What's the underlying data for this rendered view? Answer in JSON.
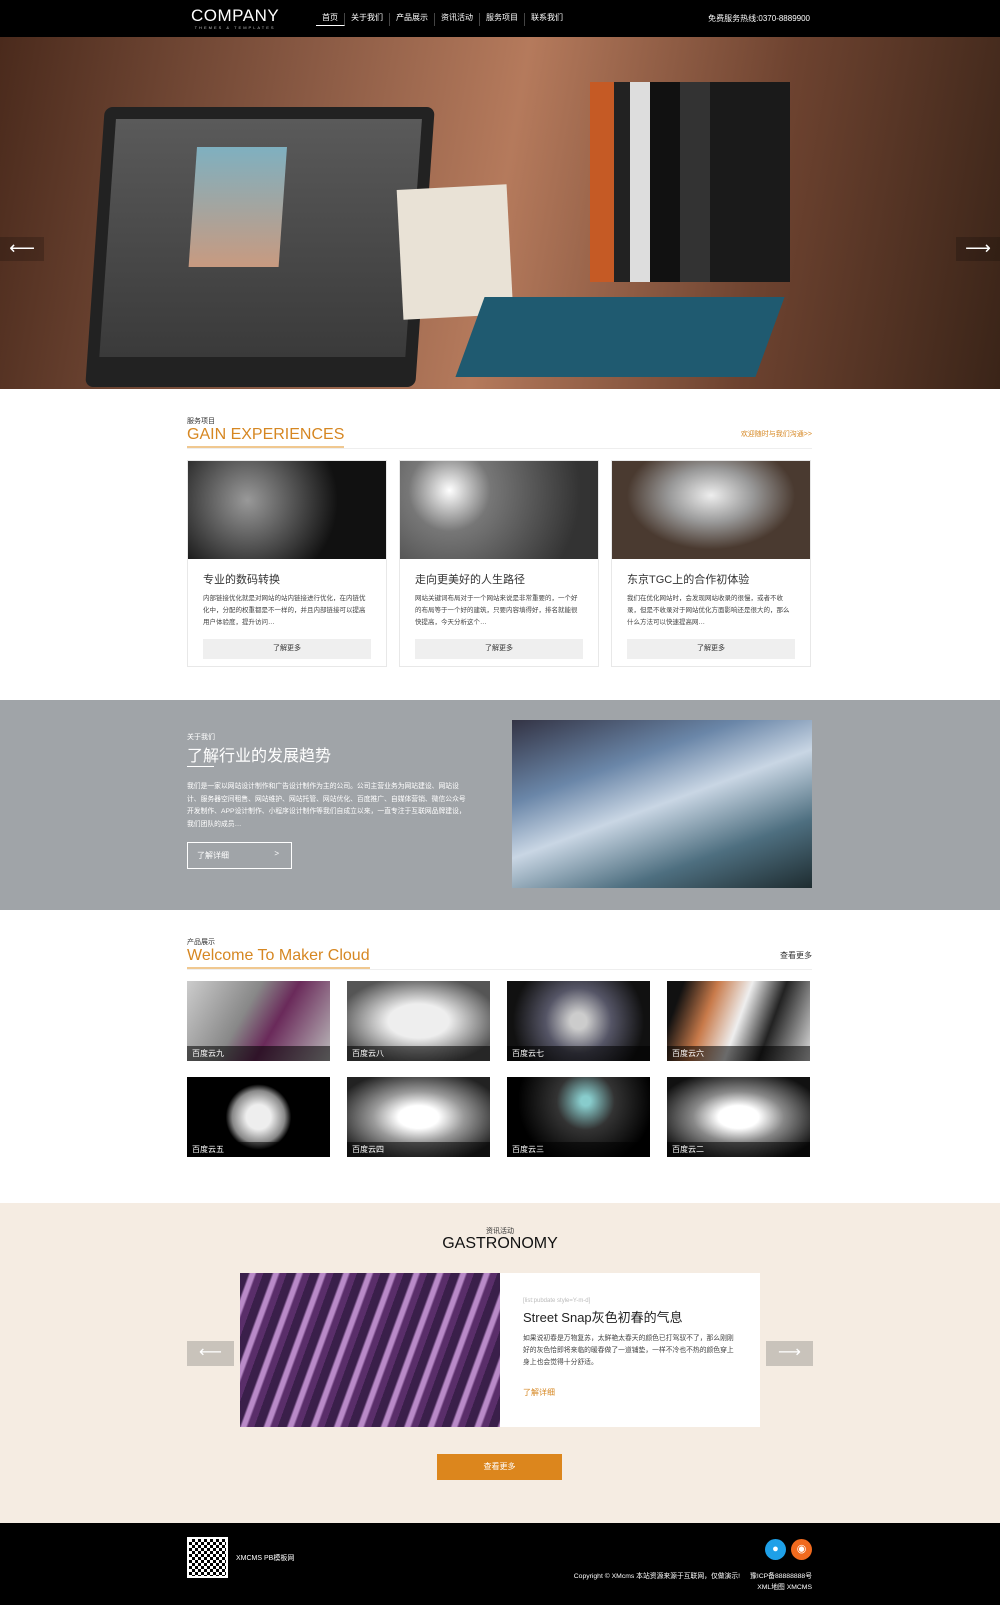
{
  "header": {
    "logo": "COMPANY",
    "logo_tagline": "THEMES & TEMPLATES",
    "nav": [
      "首页",
      "关于我们",
      "产品展示",
      "资讯活动",
      "服务项目",
      "联系我们"
    ],
    "hotline": "免费服务热线:0370-8889900"
  },
  "hero": {
    "prev_icon": "arrow-left-icon",
    "next_icon": "arrow-right-icon"
  },
  "services": {
    "subtitle": "服务项目",
    "title": "GAIN EXPERIENCES",
    "more": "欢迎随时与我们沟通>>",
    "cards": [
      {
        "title": "专业的数码转换",
        "text": "内部链接优化就是对网站的站内链接进行优化，在内链优化中，分配的权重都是不一样的，并且内部链接可以提高用户体验度，提升访问…",
        "button": "了解更多"
      },
      {
        "title": "走向更美好的人生路径",
        "text": "网站关键词布局对于一个网站来说是非常重要的，一个好的布局等于一个好的建筑，只要内容填得好，排名就能很快提高，今天分析这个…",
        "button": "了解更多"
      },
      {
        "title": "东京TGC上的合作初体验",
        "text": "我们在优化网站时，会发现网站收录的很慢，或者不收录，但是不收录对于网站优化方面影响还是很大的，那么什么方法可以快速提高网…",
        "button": "了解更多"
      }
    ]
  },
  "about": {
    "subtitle": "关于我们",
    "title": "了解行业的发展趋势",
    "text": "我们是一家以网站设计制作和广告设计制作为主的公司。公司主营业务为网站建设、网站设计、服务器空间租售、网站维护、网站托管、网站优化、百度推广、自媒体营销、微信公众号开发制作、APP设计制作、小程序设计制作等我们自成立以来，一直专注于互联网品牌建设，我们团队的成员…",
    "button": "了解详细",
    "button_arrow": ">"
  },
  "products": {
    "subtitle": "产品展示",
    "title": "Welcome To Maker Cloud",
    "more": "查看更多",
    "items": [
      "百度云九",
      "百度云八",
      "百度云七",
      "百度云六",
      "百度云五",
      "百度云四",
      "百度云三",
      "百度云二"
    ]
  },
  "news": {
    "subtitle": "资讯活动",
    "title": "GASTRONOMY",
    "date": "[list:pubdate style=Y-m-d]",
    "item_title": "Street Snap灰色初春的气息",
    "text": "如果说初春是万物复苏，太鲜艳太春天的颜色已打驾驭不了，那么刚刚好的灰色恰即将来临的暖春做了一道铺垫，一样不冷也不热的颜色穿上身上也会觉得十分舒适。",
    "link": "了解详细",
    "more": "查看更多"
  },
  "footer": {
    "site_name": "XMCMS PB模板网",
    "copyright": "Copyright © XMcms 本站资源来源于互联网，仅做演示!",
    "icp": "豫ICP备88888888号",
    "links": "XML地图 XMCMS",
    "social": [
      "qq-icon",
      "weibo-icon"
    ]
  },
  "colors": {
    "accent": "#d68722",
    "about_bg": "#a0a4a8",
    "news_bg": "#f5ece2",
    "qq": "#1ea0e8",
    "weibo": "#f06a1e"
  }
}
